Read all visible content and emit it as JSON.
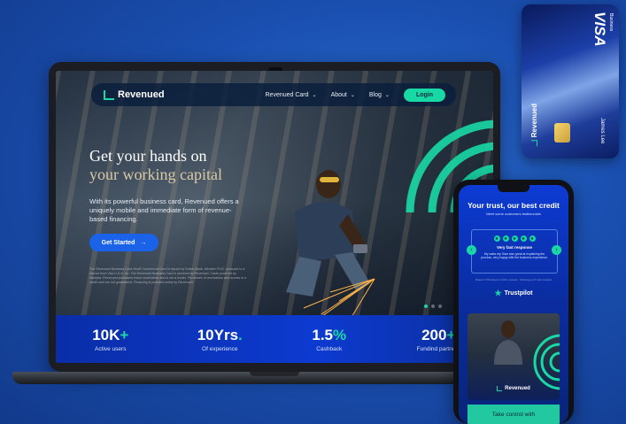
{
  "laptop": {
    "nav": {
      "logo": "Revenued",
      "links": [
        {
          "label": "Revenued Card"
        },
        {
          "label": "About"
        },
        {
          "label": "Blog"
        }
      ],
      "login": "Login"
    },
    "hero": {
      "title_line1": "Get your hands on",
      "title_line2": "your working capital",
      "text": "With its powerful business card, Revenued offers a uniquely mobile and immediate form of revenue-based financing.",
      "cta": "Get Started",
      "fine_print": "The Revenued Business Card Visa® Commercial Card is issued by Sutton Bank, Member FDIC, pursuant to a license from Visa U.S.A. Inc. The Revenued Business Card is serviced by Revenued. Cards powered by Marqeta. Revenued purchases future receivables and is not a lender. Purchases of receivables and access to a credit card are not guaranteed. Financing is provided solely by Revenued."
    },
    "stats": [
      {
        "value": "10K",
        "suffix": "+",
        "label": "Active users"
      },
      {
        "value": "10Yrs",
        "suffix": ".",
        "label": "Of experience"
      },
      {
        "value": "1.5",
        "suffix": "%",
        "label": "Cashback"
      },
      {
        "value": "200",
        "suffix": "+",
        "label": "Fundind partners"
      }
    ]
  },
  "card": {
    "network": "VISA",
    "network_sub": "Business",
    "brand": "Revenued",
    "holder": "James Lee"
  },
  "phone": {
    "title": "Your trust, our best credit",
    "subtitle": "Meet some customers testimonials",
    "review_title": "Very fast response",
    "review_body": "My sales rep Sam was great at explaining the process, very happy with the business experience.",
    "fine": "Rated 4.7/5 based on 300+ reviews · Showing our 5 star reviews",
    "trust": "Trustpilot",
    "brand": "Revenued",
    "banner": "Take control with"
  },
  "colors": {
    "accent": "#18d9a6",
    "primary": "#1a63e8",
    "background": "#1a4fb0"
  }
}
